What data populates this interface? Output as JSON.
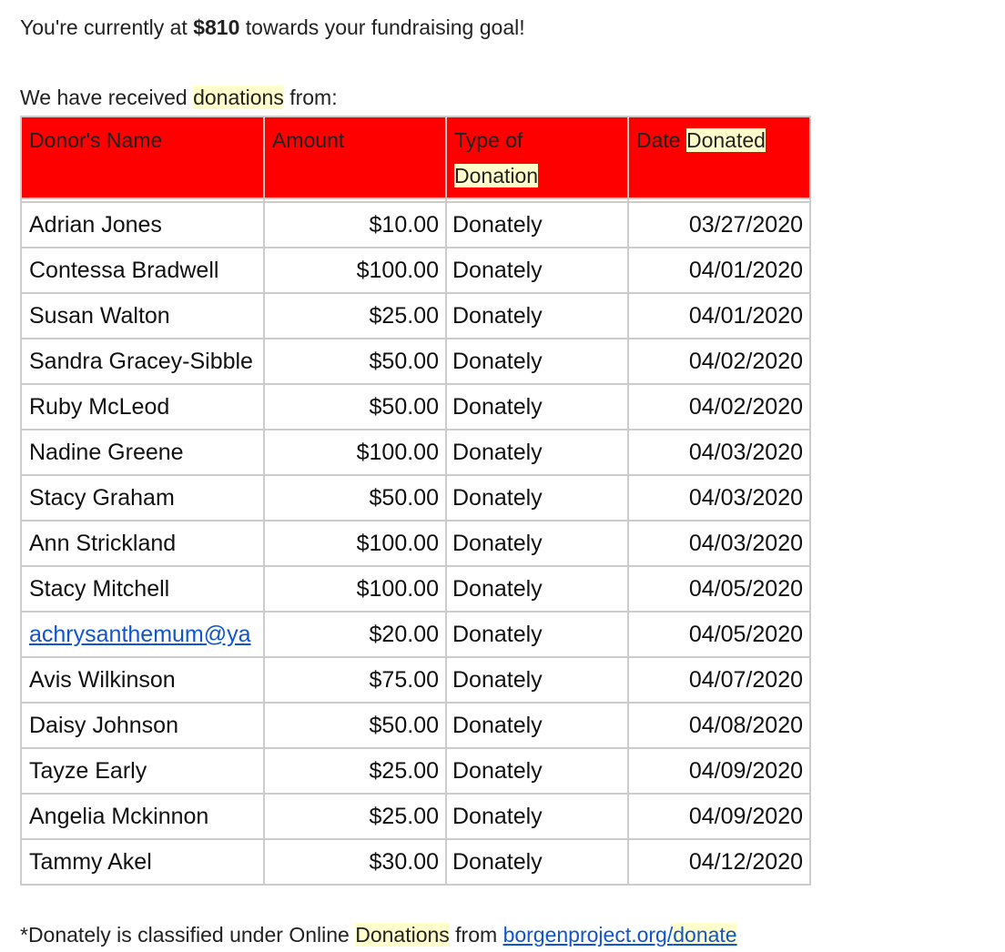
{
  "intro": {
    "prefix": "You're currently at ",
    "amount": "$810",
    "suffix": " towards your fundraising goal!"
  },
  "received": {
    "prefix": "We have received ",
    "highlight": "donations",
    "suffix": " from:"
  },
  "table": {
    "headers": {
      "name": "Donor's Name",
      "amount": "Amount",
      "type_line1": "Type of",
      "type_line2": "Donation",
      "date_prefix": "Date ",
      "date_highlight": "Donated"
    },
    "rows": [
      {
        "name": "Adrian Jones",
        "amount": "$10.00",
        "type": "Donately",
        "date": "03/27/2020",
        "is_link": false
      },
      {
        "name": "Contessa Bradwell",
        "amount": "$100.00",
        "type": "Donately",
        "date": "04/01/2020",
        "is_link": false
      },
      {
        "name": "Susan Walton",
        "amount": "$25.00",
        "type": "Donately",
        "date": "04/01/2020",
        "is_link": false
      },
      {
        "name": "Sandra Gracey-Sibble",
        "amount": "$50.00",
        "type": "Donately",
        "date": "04/02/2020",
        "is_link": false
      },
      {
        "name": "Ruby McLeod",
        "amount": "$50.00",
        "type": "Donately",
        "date": "04/02/2020",
        "is_link": false
      },
      {
        "name": "Nadine Greene",
        "amount": "$100.00",
        "type": "Donately",
        "date": "04/03/2020",
        "is_link": false
      },
      {
        "name": "Stacy Graham",
        "amount": "$50.00",
        "type": "Donately",
        "date": "04/03/2020",
        "is_link": false
      },
      {
        "name": "Ann Strickland",
        "amount": "$100.00",
        "type": "Donately",
        "date": "04/03/2020",
        "is_link": false
      },
      {
        "name": "Stacy Mitchell",
        "amount": "$100.00",
        "type": "Donately",
        "date": "04/05/2020",
        "is_link": false
      },
      {
        "name": "achrysanthemum@ya",
        "amount": "$20.00",
        "type": "Donately",
        "date": "04/05/2020",
        "is_link": true
      },
      {
        "name": "Avis Wilkinson",
        "amount": "$75.00",
        "type": "Donately",
        "date": "04/07/2020",
        "is_link": false
      },
      {
        "name": "Daisy Johnson",
        "amount": "$50.00",
        "type": "Donately",
        "date": "04/08/2020",
        "is_link": false
      },
      {
        "name": "Tayze Early",
        "amount": "$25.00",
        "type": "Donately",
        "date": "04/09/2020",
        "is_link": false
      },
      {
        "name": "Angelia Mckinnon",
        "amount": "$25.00",
        "type": "Donately",
        "date": "04/09/2020",
        "is_link": false
      },
      {
        "name": "Tammy Akel",
        "amount": "$30.00",
        "type": "Donately",
        "date": "04/12/2020",
        "is_link": false
      }
    ]
  },
  "footer": {
    "prefix": "*Donately is classified under Online ",
    "highlight": "Donations",
    "middle": " from ",
    "link_main": "borgenproject.org/",
    "link_highlight": "donate"
  },
  "colors": {
    "header_bg": "#ff0000",
    "highlight": "#ffffcc",
    "link": "#1155cc",
    "border": "#cccccc"
  }
}
